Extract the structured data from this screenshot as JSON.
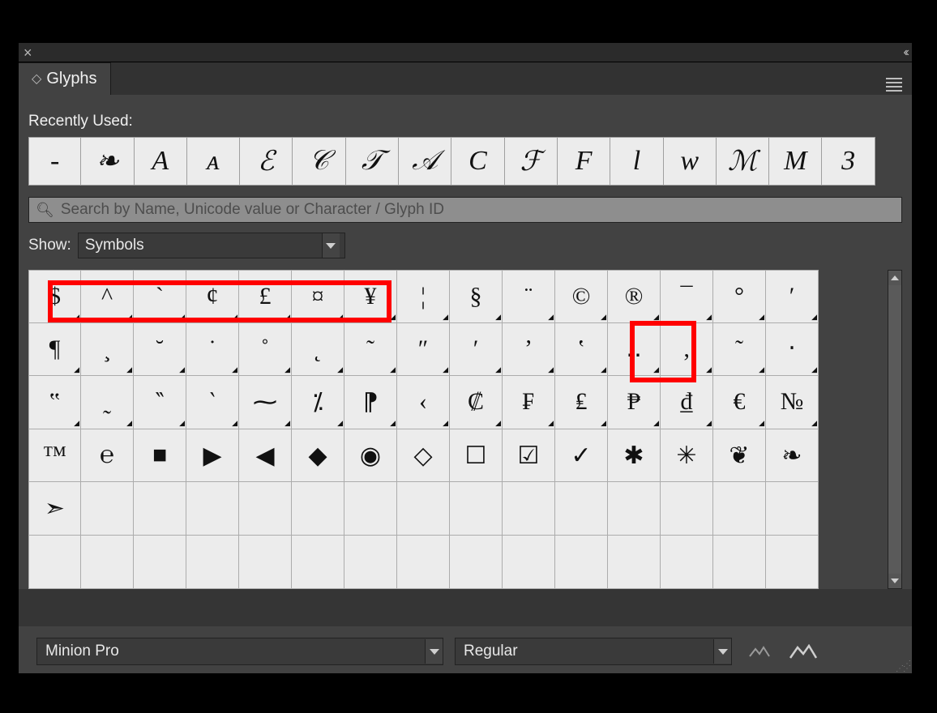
{
  "panel": {
    "title": "Glyphs"
  },
  "section_recent_label": "Recently Used:",
  "recent": [
    "-",
    "❧",
    "A",
    "ᴀ",
    "ℰ",
    "𝒞",
    "𝒯",
    "𝒜",
    "C",
    "ℱ",
    "F",
    "l",
    "w",
    "ℳ",
    "M",
    "3"
  ],
  "search": {
    "placeholder": "Search by Name, Unicode value or Character / Glyph ID"
  },
  "show": {
    "label": "Show:",
    "value": "Symbols"
  },
  "grid": [
    [
      "$",
      "^",
      "`",
      "¢",
      "£",
      "¤",
      "¥",
      "¦",
      "§",
      "¨",
      "©",
      "®",
      "¯",
      "°",
      "′"
    ],
    [
      "¶",
      "¸",
      "˘",
      "˙",
      "˚",
      "˛",
      "˜",
      "″",
      "ʹ",
      "ʼ",
      "ʽ",
      "‥",
      "‚",
      "˜",
      "‧"
    ],
    [
      "‟",
      "˷",
      "‶",
      "‵",
      "⁓",
      "⁒",
      "⁋",
      "‹",
      "₡",
      "₣",
      "₤",
      "₱",
      "₫",
      "€",
      "№"
    ],
    [
      "™",
      "℮",
      "■",
      "▶",
      "◀",
      "◆",
      "◉",
      "◇",
      "☐",
      "☑",
      "✓",
      "✱",
      "✳",
      "❦",
      "❧"
    ],
    [
      "➣",
      "",
      "",
      "",
      "",
      "",
      "",
      "",
      "",
      "",
      "",
      "",
      "",
      "",
      ""
    ],
    [
      "",
      "",
      "",
      "",
      "",
      "",
      "",
      "",
      "",
      "",
      "",
      "",
      "",
      "",
      ""
    ]
  ],
  "grid_alt_rows": [
    0,
    1,
    2
  ],
  "footer": {
    "font": "Minion Pro",
    "style": "Regular"
  }
}
